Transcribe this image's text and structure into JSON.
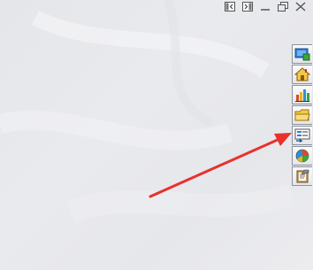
{
  "window_controls": {
    "icons": [
      "panel-left-icon",
      "panel-right-icon",
      "minimize-icon",
      "restore-icon",
      "close-icon"
    ]
  },
  "dock": {
    "buttons": [
      {
        "icon": "screen-icon"
      },
      {
        "icon": "home-icon"
      },
      {
        "icon": "bar-chart-icon"
      },
      {
        "icon": "folder-icon"
      },
      {
        "icon": "form-list-icon",
        "highlighted": true
      },
      {
        "icon": "pie-chart-icon"
      },
      {
        "icon": "clipboard-icon"
      }
    ]
  },
  "annotation": {
    "color": "#e8312b",
    "points_to": "form-list-icon"
  },
  "colors": {
    "background": "#e6e7eb",
    "arrow": "#e8312b"
  }
}
